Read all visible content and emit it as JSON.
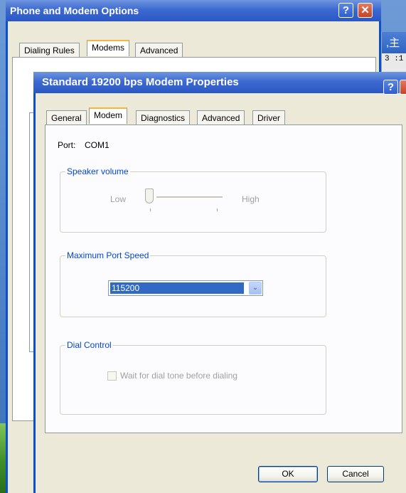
{
  "outer_dialog": {
    "title": "Phone and Modem Options",
    "tabs": [
      "Dialing Rules",
      "Modems",
      "Advanced"
    ],
    "selected_tab": "Modems"
  },
  "background_app": {
    "title_char": ",主",
    "text": "3 :1"
  },
  "inner_dialog": {
    "title": "Standard 19200 bps Modem Properties",
    "tabs": [
      "General",
      "Modem",
      "Diagnostics",
      "Advanced",
      "Driver"
    ],
    "selected_tab": "Modem",
    "port_label": "Port:",
    "port_value": "COM1",
    "speaker_group": "Speaker volume",
    "speaker_low": "Low",
    "speaker_high": "High",
    "speaker_level": 0,
    "speed_group": "Maximum Port Speed",
    "speed_value": "115200",
    "dial_group": "Dial Control",
    "dial_tone_label": "Wait for dial tone before dialing",
    "dial_tone_checked": false,
    "ok_label": "OK",
    "cancel_label": "Cancel"
  },
  "help_symbol": "?",
  "close_symbol": "✕",
  "dropdown_symbol": "⌄"
}
